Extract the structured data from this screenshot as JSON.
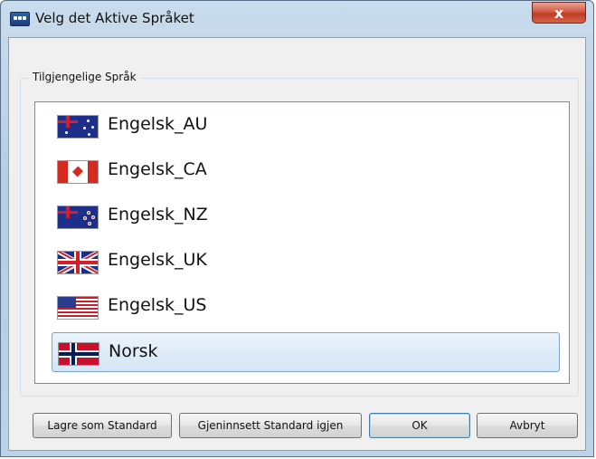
{
  "window": {
    "title": "Velg det Aktive Språket",
    "close_label": "x"
  },
  "group": {
    "label": "Tilgjengelige Språk"
  },
  "languages": [
    {
      "label": "Engelsk_AU",
      "flag": "flag-au-icon",
      "selected": false
    },
    {
      "label": "Engelsk_CA",
      "flag": "flag-ca-icon",
      "selected": false
    },
    {
      "label": "Engelsk_NZ",
      "flag": "flag-nz-icon",
      "selected": false
    },
    {
      "label": "Engelsk_UK",
      "flag": "flag-uk-icon",
      "selected": false
    },
    {
      "label": "Engelsk_US",
      "flag": "flag-us-icon",
      "selected": false
    },
    {
      "label": "Norsk",
      "flag": "flag-no-icon",
      "selected": true
    }
  ],
  "buttons": {
    "save_default": "Lagre som Standard",
    "restore_default": "Gjeninnsett Standard igjen",
    "ok": "OK",
    "cancel": "Avbryt"
  },
  "colors": {
    "selection_bg": "#d4e6f7",
    "selection_border": "#7da2ce",
    "close_button": "#c33a22"
  }
}
